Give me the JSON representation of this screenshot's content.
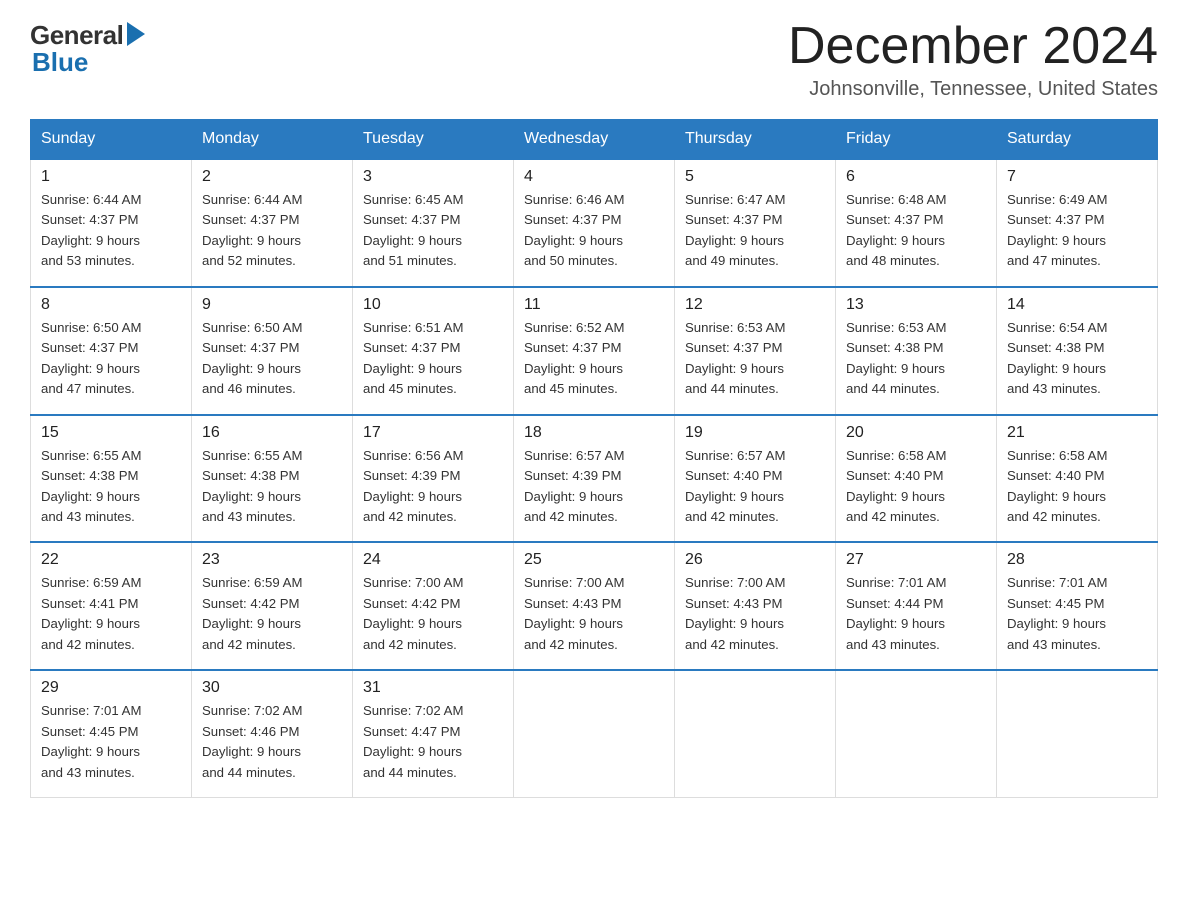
{
  "header": {
    "logo_general": "General",
    "logo_blue": "Blue",
    "month_title": "December 2024",
    "location": "Johnsonville, Tennessee, United States"
  },
  "days_of_week": [
    "Sunday",
    "Monday",
    "Tuesday",
    "Wednesday",
    "Thursday",
    "Friday",
    "Saturday"
  ],
  "weeks": [
    [
      {
        "day": "1",
        "sunrise": "6:44 AM",
        "sunset": "4:37 PM",
        "daylight": "9 hours and 53 minutes."
      },
      {
        "day": "2",
        "sunrise": "6:44 AM",
        "sunset": "4:37 PM",
        "daylight": "9 hours and 52 minutes."
      },
      {
        "day": "3",
        "sunrise": "6:45 AM",
        "sunset": "4:37 PM",
        "daylight": "9 hours and 51 minutes."
      },
      {
        "day": "4",
        "sunrise": "6:46 AM",
        "sunset": "4:37 PM",
        "daylight": "9 hours and 50 minutes."
      },
      {
        "day": "5",
        "sunrise": "6:47 AM",
        "sunset": "4:37 PM",
        "daylight": "9 hours and 49 minutes."
      },
      {
        "day": "6",
        "sunrise": "6:48 AM",
        "sunset": "4:37 PM",
        "daylight": "9 hours and 48 minutes."
      },
      {
        "day": "7",
        "sunrise": "6:49 AM",
        "sunset": "4:37 PM",
        "daylight": "9 hours and 47 minutes."
      }
    ],
    [
      {
        "day": "8",
        "sunrise": "6:50 AM",
        "sunset": "4:37 PM",
        "daylight": "9 hours and 47 minutes."
      },
      {
        "day": "9",
        "sunrise": "6:50 AM",
        "sunset": "4:37 PM",
        "daylight": "9 hours and 46 minutes."
      },
      {
        "day": "10",
        "sunrise": "6:51 AM",
        "sunset": "4:37 PM",
        "daylight": "9 hours and 45 minutes."
      },
      {
        "day": "11",
        "sunrise": "6:52 AM",
        "sunset": "4:37 PM",
        "daylight": "9 hours and 45 minutes."
      },
      {
        "day": "12",
        "sunrise": "6:53 AM",
        "sunset": "4:37 PM",
        "daylight": "9 hours and 44 minutes."
      },
      {
        "day": "13",
        "sunrise": "6:53 AM",
        "sunset": "4:38 PM",
        "daylight": "9 hours and 44 minutes."
      },
      {
        "day": "14",
        "sunrise": "6:54 AM",
        "sunset": "4:38 PM",
        "daylight": "9 hours and 43 minutes."
      }
    ],
    [
      {
        "day": "15",
        "sunrise": "6:55 AM",
        "sunset": "4:38 PM",
        "daylight": "9 hours and 43 minutes."
      },
      {
        "day": "16",
        "sunrise": "6:55 AM",
        "sunset": "4:38 PM",
        "daylight": "9 hours and 43 minutes."
      },
      {
        "day": "17",
        "sunrise": "6:56 AM",
        "sunset": "4:39 PM",
        "daylight": "9 hours and 42 minutes."
      },
      {
        "day": "18",
        "sunrise": "6:57 AM",
        "sunset": "4:39 PM",
        "daylight": "9 hours and 42 minutes."
      },
      {
        "day": "19",
        "sunrise": "6:57 AM",
        "sunset": "4:40 PM",
        "daylight": "9 hours and 42 minutes."
      },
      {
        "day": "20",
        "sunrise": "6:58 AM",
        "sunset": "4:40 PM",
        "daylight": "9 hours and 42 minutes."
      },
      {
        "day": "21",
        "sunrise": "6:58 AM",
        "sunset": "4:40 PM",
        "daylight": "9 hours and 42 minutes."
      }
    ],
    [
      {
        "day": "22",
        "sunrise": "6:59 AM",
        "sunset": "4:41 PM",
        "daylight": "9 hours and 42 minutes."
      },
      {
        "day": "23",
        "sunrise": "6:59 AM",
        "sunset": "4:42 PM",
        "daylight": "9 hours and 42 minutes."
      },
      {
        "day": "24",
        "sunrise": "7:00 AM",
        "sunset": "4:42 PM",
        "daylight": "9 hours and 42 minutes."
      },
      {
        "day": "25",
        "sunrise": "7:00 AM",
        "sunset": "4:43 PM",
        "daylight": "9 hours and 42 minutes."
      },
      {
        "day": "26",
        "sunrise": "7:00 AM",
        "sunset": "4:43 PM",
        "daylight": "9 hours and 42 minutes."
      },
      {
        "day": "27",
        "sunrise": "7:01 AM",
        "sunset": "4:44 PM",
        "daylight": "9 hours and 43 minutes."
      },
      {
        "day": "28",
        "sunrise": "7:01 AM",
        "sunset": "4:45 PM",
        "daylight": "9 hours and 43 minutes."
      }
    ],
    [
      {
        "day": "29",
        "sunrise": "7:01 AM",
        "sunset": "4:45 PM",
        "daylight": "9 hours and 43 minutes."
      },
      {
        "day": "30",
        "sunrise": "7:02 AM",
        "sunset": "4:46 PM",
        "daylight": "9 hours and 44 minutes."
      },
      {
        "day": "31",
        "sunrise": "7:02 AM",
        "sunset": "4:47 PM",
        "daylight": "9 hours and 44 minutes."
      },
      null,
      null,
      null,
      null
    ]
  ],
  "labels": {
    "sunrise": "Sunrise:",
    "sunset": "Sunset:",
    "daylight": "Daylight:"
  }
}
